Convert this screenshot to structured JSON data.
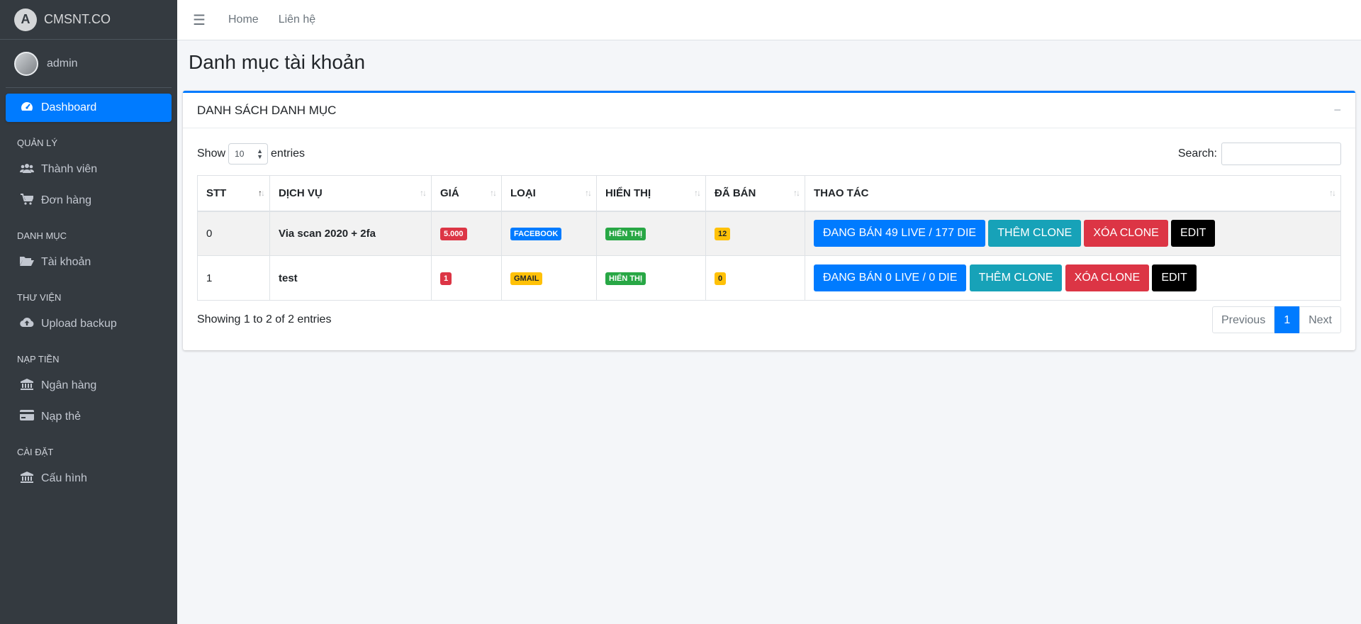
{
  "brand": {
    "name": "CMSNT.CO",
    "logo_letter": "A"
  },
  "user": {
    "name": "admin"
  },
  "sidebar": {
    "dashboard": {
      "label": "Dashboard",
      "icon": "tachometer-icon"
    },
    "groups": [
      {
        "header": "QUẢN LÝ",
        "items": [
          {
            "label": "Thành viên",
            "icon": "users-icon"
          },
          {
            "label": "Đơn hàng",
            "icon": "cart-icon"
          }
        ]
      },
      {
        "header": "DANH MỤC",
        "items": [
          {
            "label": "Tài khoản",
            "icon": "folder-open-icon"
          }
        ]
      },
      {
        "header": "THƯ VIỆN",
        "items": [
          {
            "label": "Upload backup",
            "icon": "cloud-upload-icon"
          }
        ]
      },
      {
        "header": "NẠP TIỀN",
        "items": [
          {
            "label": "Ngân hàng",
            "icon": "bank-icon"
          },
          {
            "label": "Nạp thẻ",
            "icon": "credit-card-icon"
          }
        ]
      },
      {
        "header": "CÀI ĐẶT",
        "items": [
          {
            "label": "Cấu hình",
            "icon": "bank-icon"
          }
        ]
      }
    ]
  },
  "topbar": {
    "links": [
      "Home",
      "Liên hệ"
    ]
  },
  "page": {
    "title": "Danh mục tài khoản"
  },
  "card": {
    "title": "DANH SÁCH DANH MỤC",
    "show_label": "Show",
    "entries_value": "10",
    "entries_label": "entries",
    "search_label": "Search:",
    "search_value": "",
    "columns": [
      "STT",
      "DỊCH VỤ",
      "GIÁ",
      "LOẠI",
      "HIỂN THỊ",
      "ĐÃ BÁN",
      "THAO TÁC"
    ],
    "rows": [
      {
        "stt": "0",
        "service": "Via scan 2020 + 2fa",
        "price": "5.000",
        "type": "FACEBOOK",
        "display": "HIỂN THỊ",
        "sold": "12",
        "btn_selling": "ĐANG BÁN 49 LIVE / 177 DIE",
        "btn_add": "THÊM CLONE",
        "btn_delete": "XÓA CLONE",
        "btn_edit": "EDIT"
      },
      {
        "stt": "1",
        "service": "test",
        "price": "1",
        "type": "GMAIL",
        "display": "HIỂN THỊ",
        "sold": "0",
        "btn_selling": "ĐANG BÁN 0 LIVE / 0 DIE",
        "btn_add": "THÊM CLONE",
        "btn_delete": "XÓA CLONE",
        "btn_edit": "EDIT"
      }
    ],
    "info": "Showing 1 to 2 of 2 entries",
    "pagination": {
      "prev": "Previous",
      "current": "1",
      "next": "Next"
    }
  },
  "colors": {
    "primary": "#007bff",
    "sidebar_bg": "#343a40",
    "info": "#17a2b8",
    "danger": "#dc3545",
    "warning": "#ffc107",
    "success": "#28a745"
  }
}
